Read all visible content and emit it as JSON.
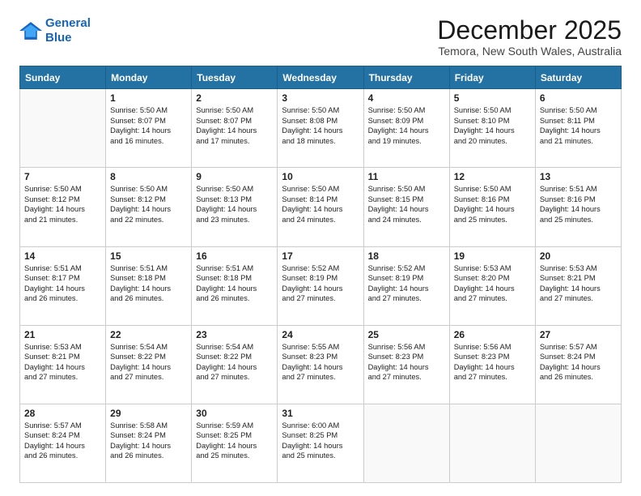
{
  "logo": {
    "line1": "General",
    "line2": "Blue"
  },
  "header": {
    "month": "December 2025",
    "location": "Temora, New South Wales, Australia"
  },
  "weekdays": [
    "Sunday",
    "Monday",
    "Tuesday",
    "Wednesday",
    "Thursday",
    "Friday",
    "Saturday"
  ],
  "weeks": [
    [
      {
        "day": "",
        "empty": true
      },
      {
        "day": "1",
        "sunrise": "5:50 AM",
        "sunset": "8:07 PM",
        "daylight": "14 hours and 16 minutes."
      },
      {
        "day": "2",
        "sunrise": "5:50 AM",
        "sunset": "8:07 PM",
        "daylight": "14 hours and 17 minutes."
      },
      {
        "day": "3",
        "sunrise": "5:50 AM",
        "sunset": "8:08 PM",
        "daylight": "14 hours and 18 minutes."
      },
      {
        "day": "4",
        "sunrise": "5:50 AM",
        "sunset": "8:09 PM",
        "daylight": "14 hours and 19 minutes."
      },
      {
        "day": "5",
        "sunrise": "5:50 AM",
        "sunset": "8:10 PM",
        "daylight": "14 hours and 20 minutes."
      },
      {
        "day": "6",
        "sunrise": "5:50 AM",
        "sunset": "8:11 PM",
        "daylight": "14 hours and 21 minutes."
      }
    ],
    [
      {
        "day": "7",
        "sunrise": "5:50 AM",
        "sunset": "8:12 PM",
        "daylight": "14 hours and 21 minutes."
      },
      {
        "day": "8",
        "sunrise": "5:50 AM",
        "sunset": "8:12 PM",
        "daylight": "14 hours and 22 minutes."
      },
      {
        "day": "9",
        "sunrise": "5:50 AM",
        "sunset": "8:13 PM",
        "daylight": "14 hours and 23 minutes."
      },
      {
        "day": "10",
        "sunrise": "5:50 AM",
        "sunset": "8:14 PM",
        "daylight": "14 hours and 24 minutes."
      },
      {
        "day": "11",
        "sunrise": "5:50 AM",
        "sunset": "8:15 PM",
        "daylight": "14 hours and 24 minutes."
      },
      {
        "day": "12",
        "sunrise": "5:50 AM",
        "sunset": "8:16 PM",
        "daylight": "14 hours and 25 minutes."
      },
      {
        "day": "13",
        "sunrise": "5:51 AM",
        "sunset": "8:16 PM",
        "daylight": "14 hours and 25 minutes."
      }
    ],
    [
      {
        "day": "14",
        "sunrise": "5:51 AM",
        "sunset": "8:17 PM",
        "daylight": "14 hours and 26 minutes."
      },
      {
        "day": "15",
        "sunrise": "5:51 AM",
        "sunset": "8:18 PM",
        "daylight": "14 hours and 26 minutes."
      },
      {
        "day": "16",
        "sunrise": "5:51 AM",
        "sunset": "8:18 PM",
        "daylight": "14 hours and 26 minutes."
      },
      {
        "day": "17",
        "sunrise": "5:52 AM",
        "sunset": "8:19 PM",
        "daylight": "14 hours and 27 minutes."
      },
      {
        "day": "18",
        "sunrise": "5:52 AM",
        "sunset": "8:19 PM",
        "daylight": "14 hours and 27 minutes."
      },
      {
        "day": "19",
        "sunrise": "5:53 AM",
        "sunset": "8:20 PM",
        "daylight": "14 hours and 27 minutes."
      },
      {
        "day": "20",
        "sunrise": "5:53 AM",
        "sunset": "8:21 PM",
        "daylight": "14 hours and 27 minutes."
      }
    ],
    [
      {
        "day": "21",
        "sunrise": "5:53 AM",
        "sunset": "8:21 PM",
        "daylight": "14 hours and 27 minutes."
      },
      {
        "day": "22",
        "sunrise": "5:54 AM",
        "sunset": "8:22 PM",
        "daylight": "14 hours and 27 minutes."
      },
      {
        "day": "23",
        "sunrise": "5:54 AM",
        "sunset": "8:22 PM",
        "daylight": "14 hours and 27 minutes."
      },
      {
        "day": "24",
        "sunrise": "5:55 AM",
        "sunset": "8:23 PM",
        "daylight": "14 hours and 27 minutes."
      },
      {
        "day": "25",
        "sunrise": "5:56 AM",
        "sunset": "8:23 PM",
        "daylight": "14 hours and 27 minutes."
      },
      {
        "day": "26",
        "sunrise": "5:56 AM",
        "sunset": "8:23 PM",
        "daylight": "14 hours and 27 minutes."
      },
      {
        "day": "27",
        "sunrise": "5:57 AM",
        "sunset": "8:24 PM",
        "daylight": "14 hours and 26 minutes."
      }
    ],
    [
      {
        "day": "28",
        "sunrise": "5:57 AM",
        "sunset": "8:24 PM",
        "daylight": "14 hours and 26 minutes."
      },
      {
        "day": "29",
        "sunrise": "5:58 AM",
        "sunset": "8:24 PM",
        "daylight": "14 hours and 26 minutes."
      },
      {
        "day": "30",
        "sunrise": "5:59 AM",
        "sunset": "8:25 PM",
        "daylight": "14 hours and 25 minutes."
      },
      {
        "day": "31",
        "sunrise": "6:00 AM",
        "sunset": "8:25 PM",
        "daylight": "14 hours and 25 minutes."
      },
      {
        "day": "",
        "empty": true
      },
      {
        "day": "",
        "empty": true
      },
      {
        "day": "",
        "empty": true
      }
    ]
  ],
  "labels": {
    "sunrise": "Sunrise:",
    "sunset": "Sunset:",
    "daylight": "Daylight:"
  }
}
